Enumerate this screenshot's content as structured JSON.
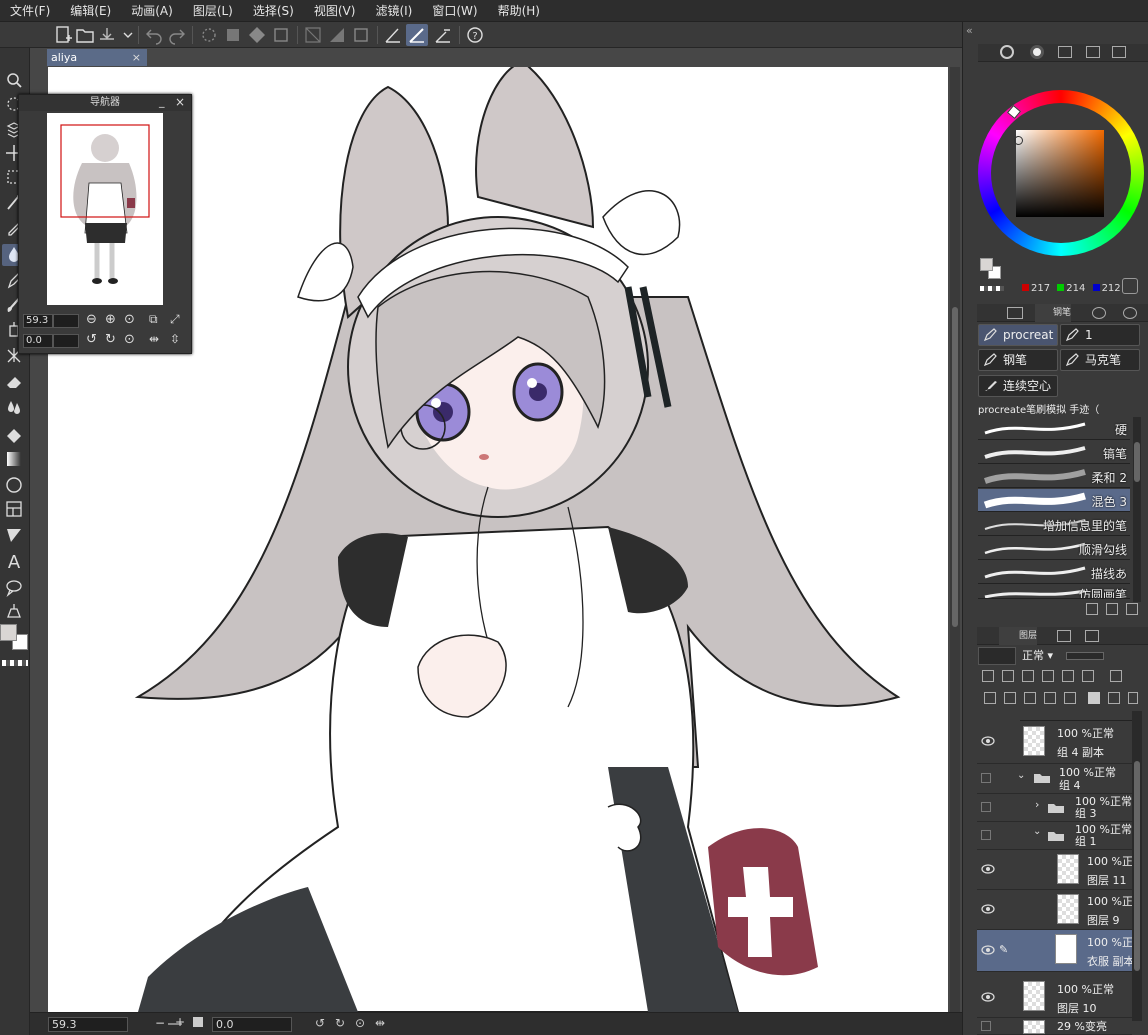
{
  "menu": [
    "文件(F)",
    "编辑(E)",
    "动画(A)",
    "图层(L)",
    "选择(S)",
    "视图(V)",
    "滤镜(I)",
    "窗口(W)",
    "帮助(H)"
  ],
  "document": {
    "tab_label": "aliya",
    "close_glyph": "×"
  },
  "navigator": {
    "title": "导航器",
    "zoom": "59.3",
    "rotation": "0.0"
  },
  "status": {
    "zoom": "59.3",
    "rotation": "0.0"
  },
  "color": {
    "r": "217",
    "g": "214",
    "b": "212",
    "main_color": "#d9d6d4",
    "accent": "#5a6a8a"
  },
  "brush_tabs": {
    "tab_label": "钢笔"
  },
  "brush_tools": [
    "procreat",
    "1",
    "钢笔",
    "马克笔",
    "连续空心"
  ],
  "brush_group": "procreate笔刷模拟 手迹（",
  "brushes": [
    {
      "name": "硬"
    },
    {
      "name": "镐笔"
    },
    {
      "name": "柔和 2"
    },
    {
      "name": "混色 3"
    },
    {
      "name": "增加信息里的笔"
    },
    {
      "name": "顺滑勾线"
    },
    {
      "name": "描线あ"
    },
    {
      "name": "仿圆画笔"
    }
  ],
  "layers_panel": {
    "tab_label": "图层",
    "blend_mode": "正常"
  },
  "layers": [
    {
      "opacity": "100 %正常",
      "name": "组 4 副本"
    },
    {
      "opacity": "100 %正常",
      "name": "组 4"
    },
    {
      "opacity": "100 %正常",
      "name": "组 3"
    },
    {
      "opacity": "100 %正常",
      "name": "组 1"
    },
    {
      "opacity": "100 %正",
      "name": "图层 11"
    },
    {
      "opacity": "100 %正",
      "name": "图层 9"
    },
    {
      "opacity": "100 %正",
      "name": "衣服 副本"
    },
    {
      "opacity": "100 %正常",
      "name": "图层 10"
    },
    {
      "opacity": "29 %变亮",
      "name": ""
    }
  ]
}
